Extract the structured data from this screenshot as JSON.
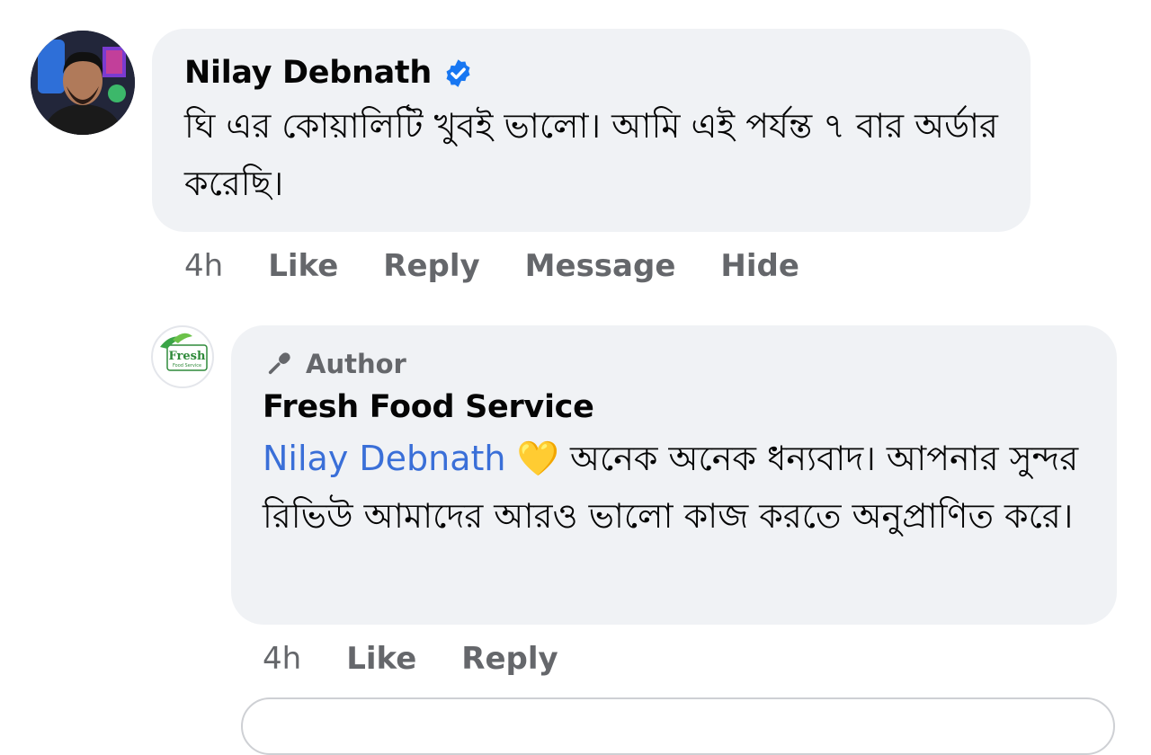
{
  "comment": {
    "author": "Nilay Debnath",
    "text": "ঘি এর কোয়ালিটি খুবই ভালো। আমি এই পর্যন্ত ৭ বার অর্ডার করেছি।",
    "time": "4h",
    "actions": [
      "Like",
      "Reply",
      "Message",
      "Hide"
    ]
  },
  "reply": {
    "badge": "Author",
    "author": "Fresh Food Service",
    "logo_text": "Fresh",
    "logo_subtext": "Food Service",
    "mention": "Nilay Debnath",
    "emoji": "💛",
    "text": "অনেক অনেক ধন্যবাদ। আপনার সুন্দর রিভিউ আমাদের আরও ভালো কাজ করতে অনুপ্রাণিত করে।",
    "time": "4h",
    "actions": [
      "Like",
      "Reply"
    ]
  }
}
